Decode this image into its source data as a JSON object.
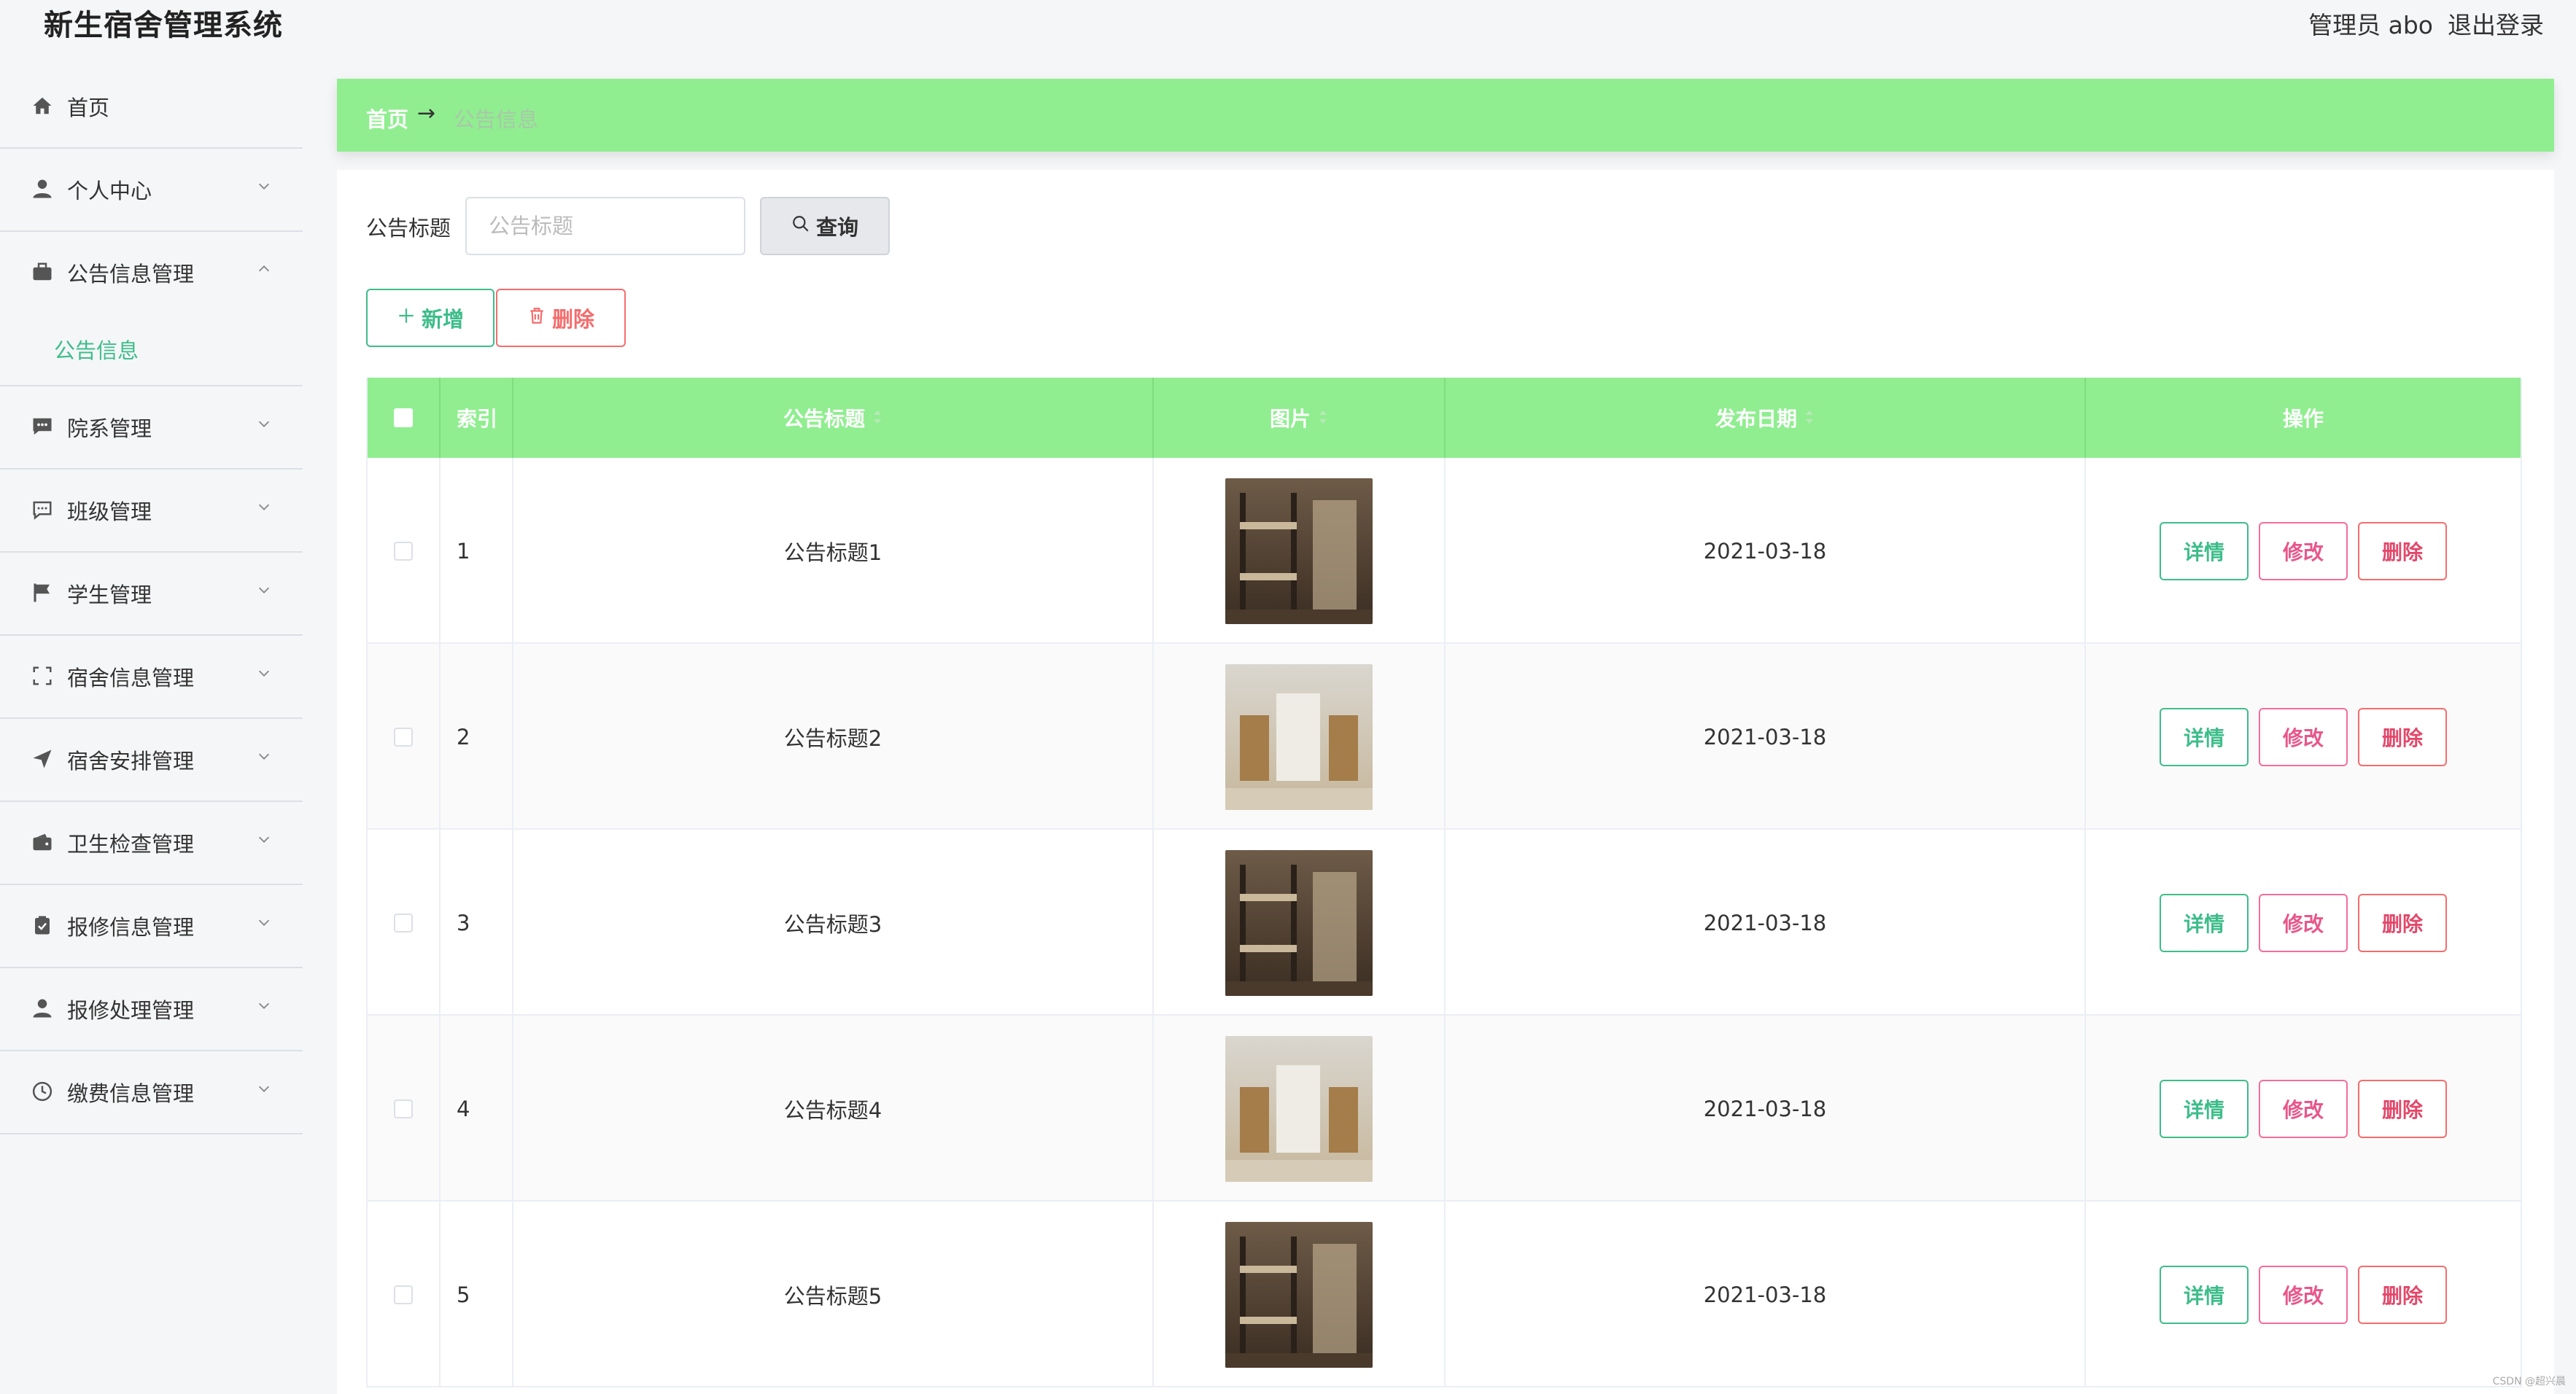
{
  "app": {
    "title": "新生宿舍管理系统",
    "user": "管理员 abo",
    "logout": "退出登录"
  },
  "sidebar": {
    "items": [
      {
        "label": "首页",
        "icon": "home-icon",
        "arrow": false
      },
      {
        "label": "个人中心",
        "icon": "user-icon",
        "arrow": true
      },
      {
        "label": "公告信息管理",
        "icon": "briefcase-icon",
        "arrow": true,
        "open": true,
        "sub": "公告信息"
      },
      {
        "label": "院系管理",
        "icon": "chat-icon",
        "arrow": true
      },
      {
        "label": "班级管理",
        "icon": "message-icon",
        "arrow": true
      },
      {
        "label": "学生管理",
        "icon": "flag-icon",
        "arrow": true
      },
      {
        "label": "宿舍信息管理",
        "icon": "fullscreen-icon",
        "arrow": true
      },
      {
        "label": "宿舍安排管理",
        "icon": "send-icon",
        "arrow": true
      },
      {
        "label": "卫生检查管理",
        "icon": "wallet-icon",
        "arrow": true
      },
      {
        "label": "报修信息管理",
        "icon": "clipboard-icon",
        "arrow": true
      },
      {
        "label": "报修处理管理",
        "icon": "user-icon",
        "arrow": true
      },
      {
        "label": "缴费信息管理",
        "icon": "clock-icon",
        "arrow": true
      }
    ]
  },
  "breadcrumb": {
    "home": "首页",
    "arrow": "→",
    "current": "公告信息"
  },
  "search": {
    "label": "公告标题",
    "placeholder": "公告标题",
    "button": "查询"
  },
  "toolbar": {
    "add": "新增",
    "delete": "删除"
  },
  "table": {
    "columns": {
      "index": "索引",
      "title": "公告标题",
      "image": "图片",
      "date": "发布日期",
      "ops": "操作"
    },
    "rows": [
      {
        "index": "1",
        "title": "公告标题1",
        "date": "2021-03-18",
        "image": "dorm-room-photo"
      },
      {
        "index": "2",
        "title": "公告标题2",
        "date": "2021-03-18",
        "image": "dorm-room-photo"
      },
      {
        "index": "3",
        "title": "公告标题3",
        "date": "2021-03-18",
        "image": "dorm-room-photo"
      },
      {
        "index": "4",
        "title": "公告标题4",
        "date": "2021-03-18",
        "image": "dorm-room-photo"
      },
      {
        "index": "5",
        "title": "公告标题5",
        "date": "2021-03-18",
        "image": "dorm-room-photo"
      }
    ],
    "actions": {
      "detail": "详情",
      "edit": "修改",
      "remove": "删除"
    }
  },
  "watermark": "CSDN @超兴晨",
  "colors": {
    "accent": "#90ee90",
    "primary_green": "#3dbd8a",
    "danger": "#f56c6c",
    "edit_pink": "#e8578a"
  }
}
